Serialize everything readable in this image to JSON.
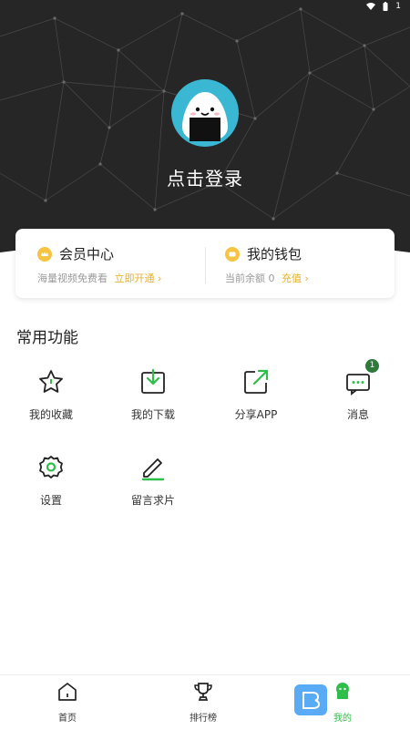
{
  "colors": {
    "header_bg": "#262626",
    "accent_green": "#2fbe4a",
    "coin_yellow": "#f6c343",
    "link_gold": "#e6b12a",
    "badge_green": "#2d7a3b",
    "avatar_bg": "#39b7d3"
  },
  "header": {
    "login_label": "点击登录"
  },
  "card": {
    "vip": {
      "icon": "crown-coin-icon",
      "title": "会员中心",
      "subtitle": "海量视频免费看",
      "action": "立即开通 ›"
    },
    "wallet": {
      "icon": "wallet-coin-icon",
      "title": "我的钱包",
      "subtitle": "当前余额 0",
      "action": "充值 ›"
    }
  },
  "section": {
    "title": "常用功能",
    "items": [
      {
        "label": "我的收藏",
        "icon": "star-icon"
      },
      {
        "label": "我的下载",
        "icon": "download-icon"
      },
      {
        "label": "分享APP",
        "icon": "share-icon"
      },
      {
        "label": "消息",
        "icon": "message-icon",
        "badge": "1"
      },
      {
        "label": "设置",
        "icon": "gear-icon"
      },
      {
        "label": "留言求片",
        "icon": "edit-icon"
      }
    ]
  },
  "nav": {
    "items": [
      {
        "label": "首页",
        "icon": "home-icon"
      },
      {
        "label": "排行榜",
        "icon": "trophy-icon"
      },
      {
        "label": "我的",
        "icon": "profile-icon",
        "active": true
      }
    ]
  }
}
